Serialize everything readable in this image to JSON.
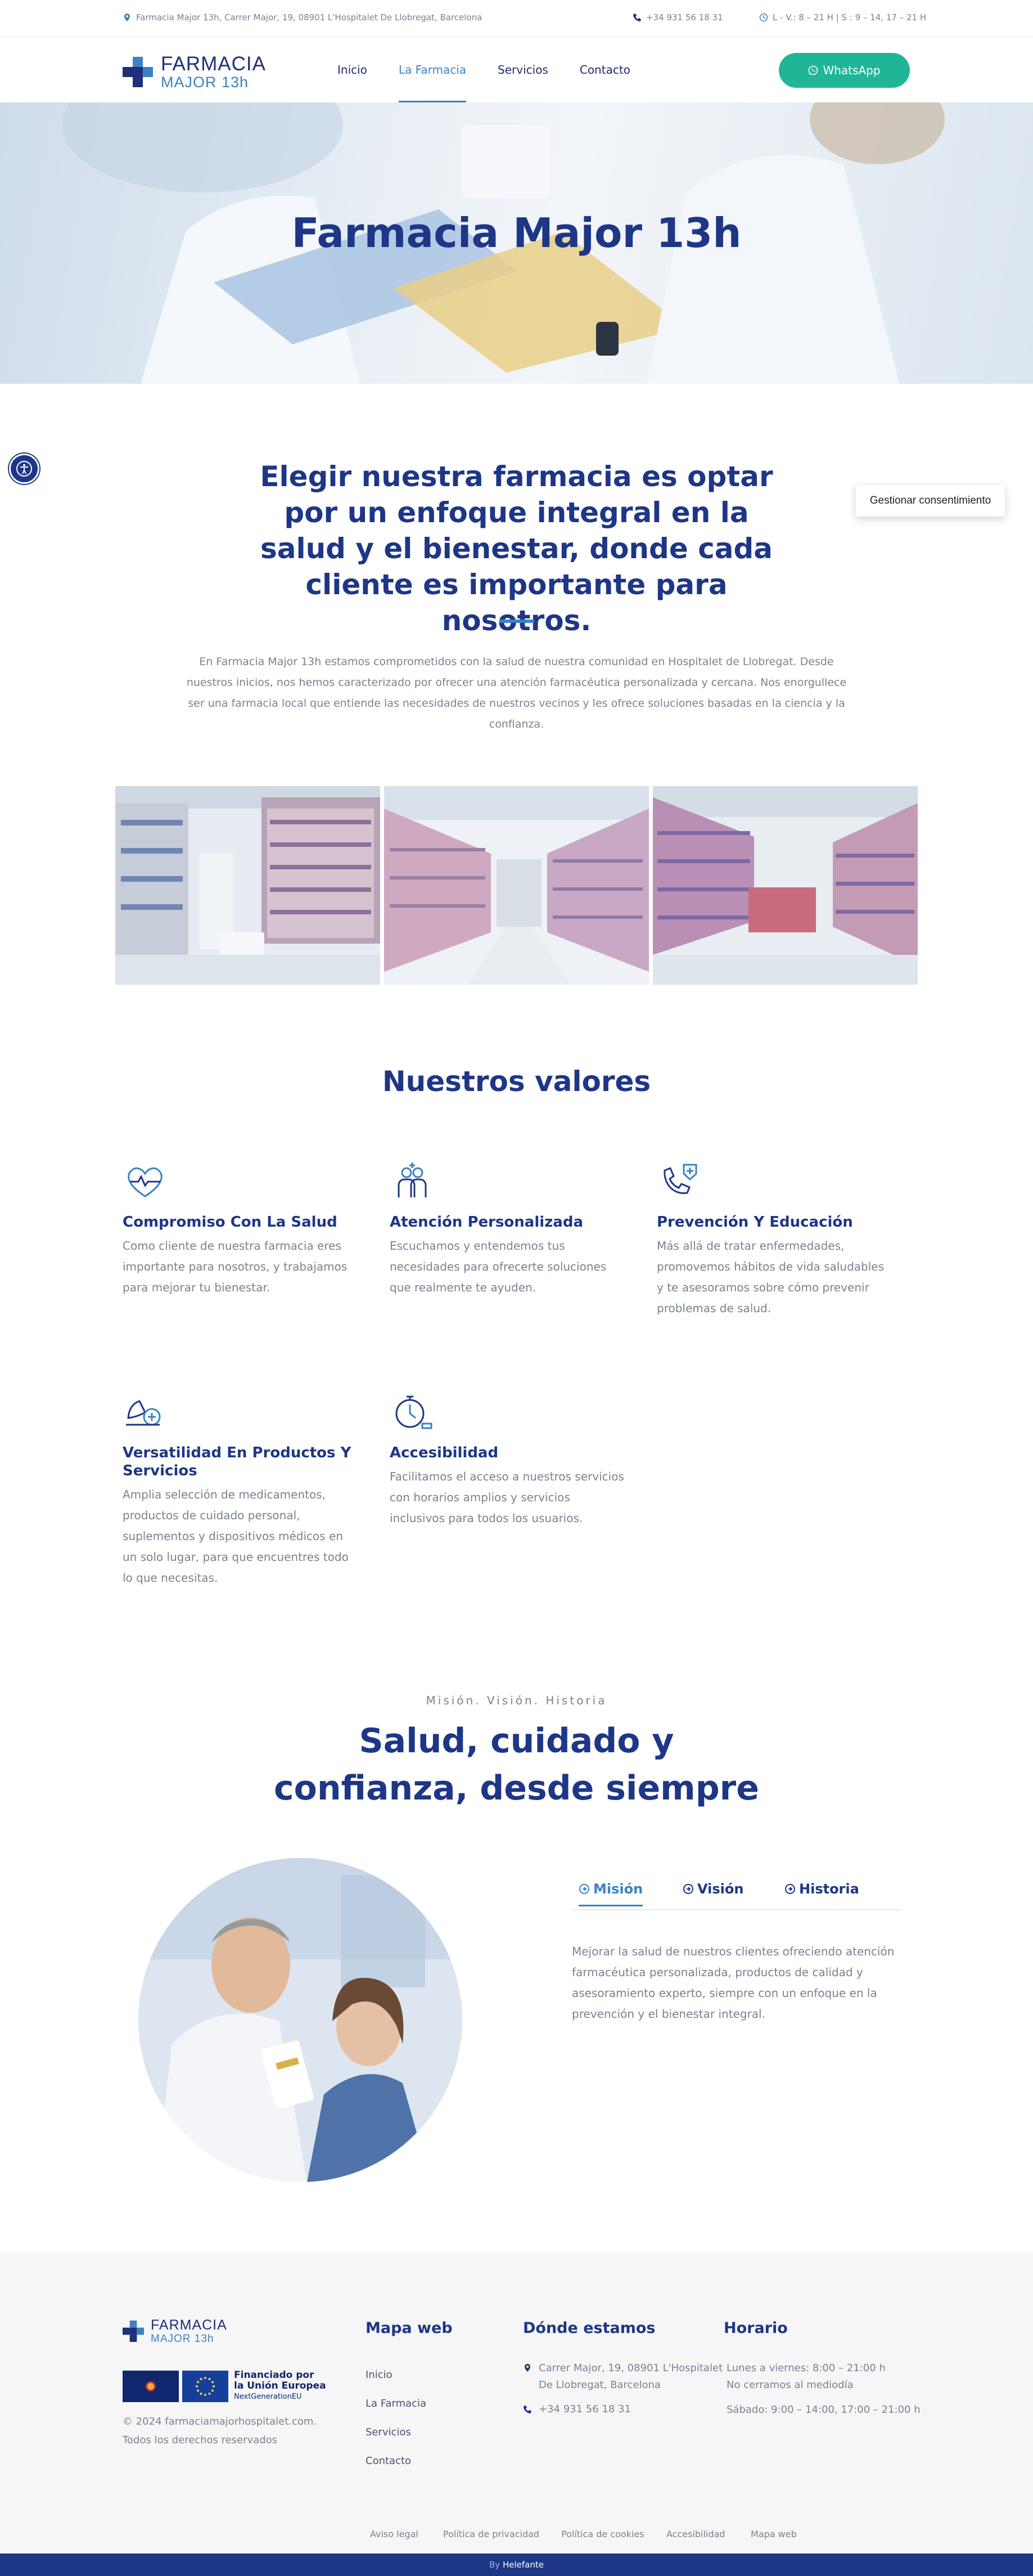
{
  "topbar": {
    "address": "Farmacia Major 13h, Carrer Major, 19, 08901 L'Hospitalet De Llobregat, Barcelona",
    "phone": "+34 931 56 18 31",
    "hours": "L - V.: 8 – 21 H | S : 9 – 14, 17 – 21 H"
  },
  "header": {
    "logo_line1": "FARMACIA",
    "logo_line2": "MAJOR 13h",
    "nav": [
      "Inicio",
      "La Farmacia",
      "Servicios",
      "Contacto"
    ],
    "active_nav": "La Farmacia",
    "whatsapp_label": "WhatsApp"
  },
  "hero": {
    "title": "Farmacia Major 13h"
  },
  "intro": {
    "title": "Elegir nuestra farmacia es optar por un enfoque integral en la salud y el bienestar, donde cada cliente es importante para nosotros.",
    "body": "En Farmacia Major 13h estamos comprometidos con la salud de nuestra comunidad en Hospitalet de Llobregat. Desde nuestros inicios, nos hemos caracterizado por ofrecer una atención farmacéutica personalizada y cercana. Nos enorgullece ser una farmacia local que entiende las necesidades de nuestros vecinos y les ofrece soluciones basadas en la ciencia y la confianza."
  },
  "values": {
    "title": "Nuestros valores",
    "items": [
      {
        "title": "Compromiso Con La Salud",
        "icon": "heart-pulse-icon",
        "text": "Como cliente de nuestra farmacia eres importante para nosotros, y trabajamos para mejorar tu bienestar."
      },
      {
        "title": "Atención Personalizada",
        "icon": "people-icon",
        "text": "Escuchamos y entendemos tus necesidades para ofrecerte soluciones que realmente te ayuden."
      },
      {
        "title": "Prevención Y Educación",
        "icon": "phone-shield-icon",
        "text": "Más allá de tratar enfermedades, promovemos hábitos de vida saludables y te asesoramos sobre cómo prevenir problemas de salud."
      },
      {
        "title": "Versatilidad En Productos Y Servicios",
        "icon": "products-icon",
        "text": "Amplia selección de medicamentos, productos de cuidado personal, suplementos y dispositivos médicos en un solo lugar, para que encuentres todo lo que necesitas."
      },
      {
        "title": "Accesibilidad",
        "icon": "clock-access-icon",
        "text": "Facilitamos el acceso a nuestros servicios con horarios amplios y servicios inclusivos para todos los usuarios."
      }
    ]
  },
  "mvh": {
    "eyebrow": "Misión. Visión. Historia",
    "title": "Salud, cuidado y confianza, desde siempre",
    "tabs": [
      "Misión",
      "Visión",
      "Historia"
    ],
    "active_tab": "Misión",
    "body": "Mejorar la salud de nuestros clientes ofreciendo atención farmacéutica personalizada, productos de calidad y asesoramiento experto, siempre con un enfoque en la prevención y el bienestar integral."
  },
  "footer": {
    "logo_line1": "FARMACIA",
    "logo_line2": "MAJOR 13h",
    "eu_label_1": "Financiado por",
    "eu_label_2": "la Unión Europea",
    "eu_label_3": "NextGenerationEU",
    "copyright_1": "© 2024 farmaciamajorhospitalet.com.",
    "copyright_2": "Todos los derechos reservados",
    "sitemap_title": "Mapa web",
    "sitemap_links": [
      "Inicio",
      "La Farmacia",
      "Servicios",
      "Contacto"
    ],
    "where_title": "Dónde estamos",
    "address_1": "Carrer Major, 19, 08901 L'Hospitalet",
    "address_2": "De Llobregat, Barcelona",
    "phone": "+34 931 56 18 31",
    "hours_title": "Horario",
    "hours_1": "Lunes a viernes: 8:00 – 21:00 h",
    "hours_2": "No cerramos al mediodía",
    "hours_3": "Sábado: 9:00 – 14:00, 17:00 – 21:00 h",
    "bottom_links": [
      "Aviso legal",
      "Política de privacidad",
      "Política de cookies",
      "Accesibilidad",
      "Mapa web"
    ],
    "by_label": "By",
    "by_brand": "Helefante"
  },
  "widgets": {
    "consent_label": "Gestionar consentimiento"
  },
  "colors": {
    "brand_dark": "#1e3686",
    "brand_light": "#3b82c4",
    "whatsapp": "#21b597",
    "footer_bg": "#f6f6f7"
  }
}
